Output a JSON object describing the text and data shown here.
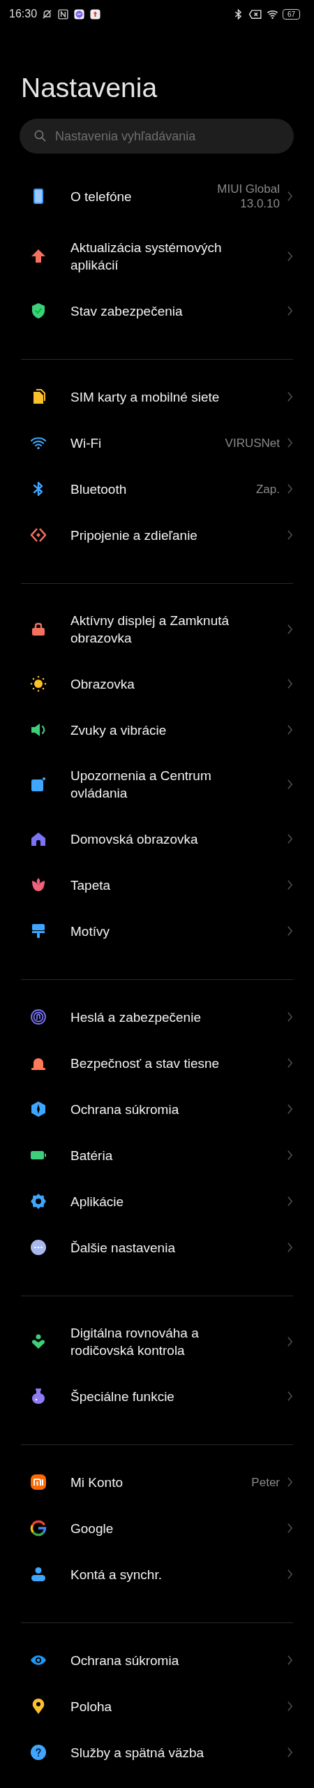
{
  "status_bar": {
    "time": "16:30",
    "battery": "67"
  },
  "title": "Nastavenia",
  "search": {
    "placeholder": "Nastavenia vyhľadávania"
  },
  "sections": [
    {
      "items": [
        {
          "label": "O telefóne",
          "value": "MIUI Global 13.0.10"
        },
        {
          "label": "Aktualizácia systémových aplikácií"
        },
        {
          "label": "Stav zabezpečenia"
        }
      ]
    },
    {
      "items": [
        {
          "label": "SIM karty a mobilné siete"
        },
        {
          "label": "Wi-Fi",
          "value": "VIRUSNet"
        },
        {
          "label": "Bluetooth",
          "value": "Zap."
        },
        {
          "label": "Pripojenie a zdieľanie"
        }
      ]
    },
    {
      "items": [
        {
          "label": "Aktívny displej a Zamknutá obrazovka"
        },
        {
          "label": "Obrazovka"
        },
        {
          "label": "Zvuky a vibrácie"
        },
        {
          "label": "Upozornenia a Centrum ovládania"
        },
        {
          "label": "Domovská obrazovka"
        },
        {
          "label": "Tapeta"
        },
        {
          "label": "Motívy"
        }
      ]
    },
    {
      "items": [
        {
          "label": "Heslá a zabezpečenie"
        },
        {
          "label": "Bezpečnosť a stav tiesne"
        },
        {
          "label": "Ochrana súkromia"
        },
        {
          "label": "Batéria"
        },
        {
          "label": "Aplikácie"
        },
        {
          "label": "Ďalšie nastavenia"
        }
      ]
    },
    {
      "items": [
        {
          "label": "Digitálna rovnováha a rodičovská kontrola"
        },
        {
          "label": "Špeciálne funkcie"
        }
      ]
    },
    {
      "items": [
        {
          "label": "Mi Konto",
          "value": "Peter"
        },
        {
          "label": "Google"
        },
        {
          "label": "Kontá a synchr."
        }
      ]
    },
    {
      "items": [
        {
          "label": "Ochrana súkromia"
        },
        {
          "label": "Poloha"
        },
        {
          "label": "Služby a spätná väzba"
        }
      ]
    }
  ]
}
